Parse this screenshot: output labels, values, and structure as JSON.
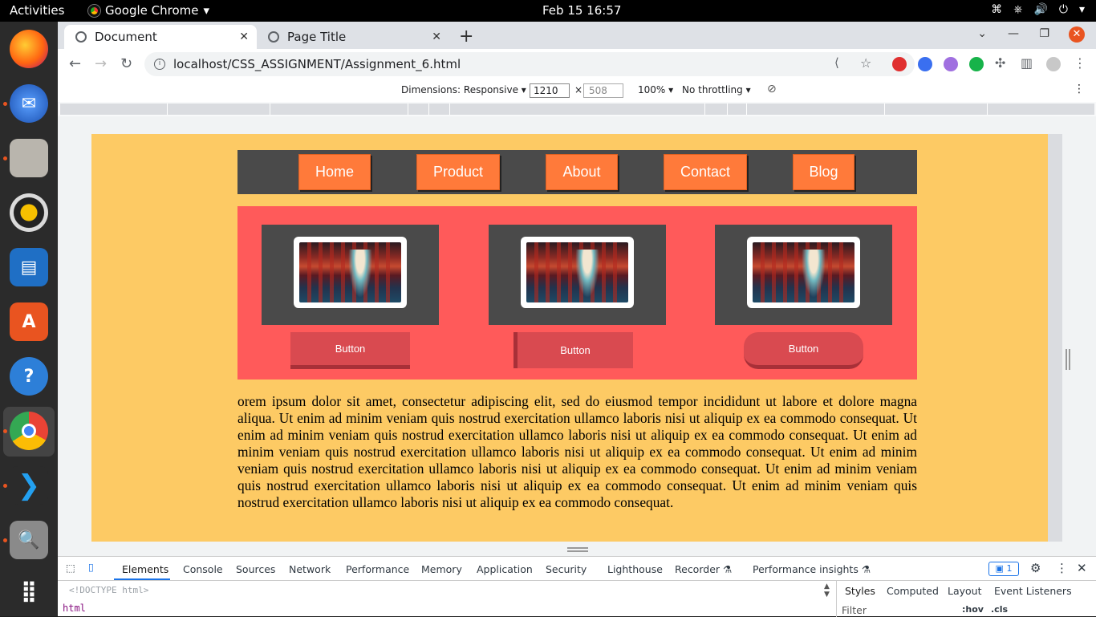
{
  "topbar": {
    "activities": "Activities",
    "app_name": "Google Chrome",
    "clock": "Feb 15  16:57"
  },
  "tabs": [
    {
      "title": "Document",
      "active": true
    },
    {
      "title": "Page Title",
      "active": false
    }
  ],
  "address_bar": {
    "url": "localhost/CSS_ASSIGNMENT/Assignment_6.html"
  },
  "device_toolbar": {
    "dimensions": "Dimensions: Responsive",
    "width": "1210",
    "height": "508",
    "zoom": "100%",
    "throttling": "No throttling"
  },
  "page": {
    "background": "#fdca64",
    "nav": [
      "Home",
      "Product",
      "About",
      "Contact",
      "Blog"
    ],
    "nav_color": "#ff7a3a",
    "cards": [
      {
        "button": "Button"
      },
      {
        "button": "Button"
      },
      {
        "button": "Button"
      }
    ],
    "paragraph": "orem ipsum dolor sit amet, consectetur adipiscing elit, sed do eiusmod tempor incididunt ut labore et dolore magna aliqua. Ut enim ad minim veniam quis nostrud exercitation ullamco laboris nisi ut aliquip ex ea commodo consequat. Ut enim ad minim veniam quis nostrud exercitation ullamco laboris nisi ut aliquip ex ea commodo consequat. Ut enim ad minim veniam quis nostrud exercitation ullamco laboris nisi ut aliquip ex ea commodo consequat. Ut enim ad minim veniam quis nostrud exercitation ullamco laboris nisi ut aliquip ex ea commodo consequat. Ut enim ad minim veniam quis nostrud exercitation ullamco laboris nisi ut aliquip ex ea commodo consequat. Ut enim ad minim veniam quis nostrud exercitation ullamco laboris nisi ut aliquip ex ea commodo consequat."
  },
  "devtools": {
    "tabs": [
      "Elements",
      "Console",
      "Sources",
      "Network",
      "Performance",
      "Memory",
      "Application",
      "Security",
      "Lighthouse",
      "Recorder",
      "Performance insights"
    ],
    "issues_count": "1",
    "doctype": "<!DOCTYPE html>",
    "html_tag": "html",
    "styles_tabs": [
      "Styles",
      "Computed",
      "Layout",
      "Event Listeners"
    ],
    "filter_placeholder": "Filter",
    "hov": ":hov",
    "cls": ".cls"
  }
}
